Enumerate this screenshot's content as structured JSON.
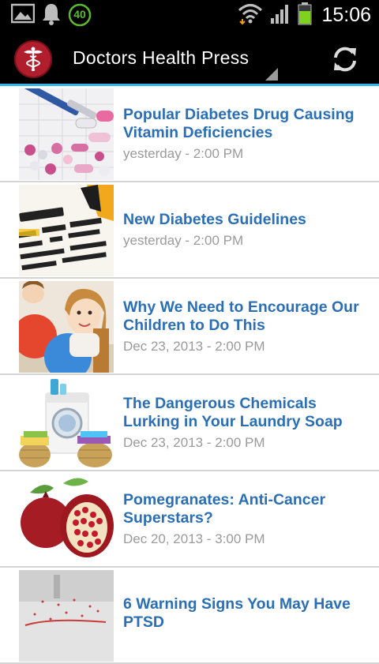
{
  "status_bar": {
    "time": "15:06",
    "notification_count": "40",
    "icons": [
      "gallery-icon",
      "bell-icon",
      "badge-icon",
      "wifi-icon",
      "signal-icon",
      "battery-icon"
    ],
    "battery_color": "#7ed321"
  },
  "action_bar": {
    "title": "Doctors Health Press",
    "logo_icon": "caduceus-icon",
    "refresh_icon": "refresh-icon",
    "accent_color": "#33b5e5",
    "logo_color": "#b01e2e"
  },
  "articles": [
    {
      "title": "Popular Diabetes Drug Causing Vitamin Deficiencies",
      "date": "yesterday - 2:00 PM",
      "thumbnail": "pills-thumbnail"
    },
    {
      "title": "New Diabetes Guidelines",
      "date": "yesterday - 2:00 PM",
      "thumbnail": "diabetes-text-thumbnail"
    },
    {
      "title": "Why We Need to Encourage Our Children to Do This",
      "date": "Dec 23, 2013 - 2:00 PM",
      "thumbnail": "children-exercise-thumbnail"
    },
    {
      "title": "The Dangerous Chemicals Lurking in Your Laundry Soap",
      "date": "Dec 23, 2013 - 2:00 PM",
      "thumbnail": "laundry-thumbnail"
    },
    {
      "title": "Pomegranates: Anti-Cancer Superstars?",
      "date": "Dec 20, 2013 - 3:00 PM",
      "thumbnail": "pomegranate-thumbnail"
    },
    {
      "title": "6 Warning Signs You May Have PTSD",
      "date": "",
      "thumbnail": "stress-thumbnail"
    }
  ],
  "colors": {
    "title_text": "#2a6fb5",
    "date_text": "#9a9a9a",
    "divider": "#d4d4d4"
  }
}
